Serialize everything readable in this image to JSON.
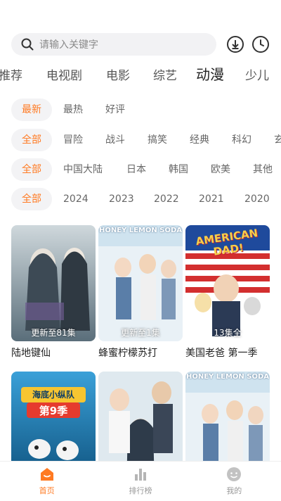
{
  "search": {
    "placeholder": "请输入关键字"
  },
  "icons": {
    "search": "search-icon",
    "download": "download-icon",
    "history": "history-clock-icon"
  },
  "nav_tabs": [
    {
      "label": "推荐"
    },
    {
      "label": "电视剧"
    },
    {
      "label": "电影"
    },
    {
      "label": "综艺"
    },
    {
      "label": "动漫"
    },
    {
      "label": "少儿"
    }
  ],
  "filters": {
    "sort": [
      "最新",
      "最热",
      "好评"
    ],
    "genre": [
      "全部",
      "冒险",
      "战斗",
      "搞笑",
      "经典",
      "科幻",
      "玄"
    ],
    "region": [
      "全部",
      "中国大陆",
      "日本",
      "韩国",
      "欧美",
      "其他"
    ],
    "year": [
      "全部",
      "2024",
      "2023",
      "2022",
      "2021",
      "2020"
    ]
  },
  "cards": [
    {
      "title": "陆地键仙",
      "badge": "更新至81集"
    },
    {
      "title": "蜂蜜柠檬苏打",
      "badge": "更新至1集"
    },
    {
      "title": "美国老爸 第一季",
      "badge": "13集全"
    },
    {
      "title": "",
      "badge": ""
    },
    {
      "title": "",
      "badge": ""
    },
    {
      "title": "",
      "badge": ""
    }
  ],
  "posters": {
    "p3_text": "第9季",
    "p3_brand": "海底小纵队",
    "p2_brand": "HONEY LEMON SODA",
    "p4_brand": "AMERICAN DAD!"
  },
  "bottom_nav": [
    {
      "label": "首页"
    },
    {
      "label": "排行榜"
    },
    {
      "label": "我的"
    }
  ],
  "colors": {
    "accent": "#ff7a22"
  }
}
